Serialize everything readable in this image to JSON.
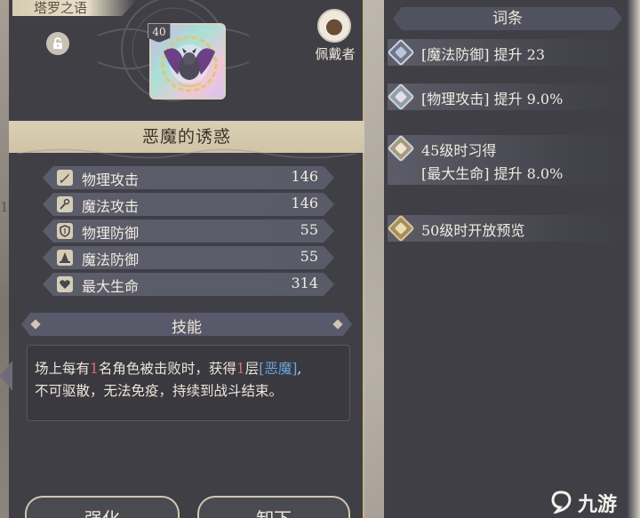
{
  "panel_title": "塔罗之语",
  "item": {
    "level": "40",
    "name": "恶魔的诱惑"
  },
  "wearer": {
    "label": "佩戴者"
  },
  "stats": [
    {
      "name": "物理攻击",
      "value": "146",
      "icon": "sword-icon"
    },
    {
      "name": "魔法攻击",
      "value": "146",
      "icon": "wand-icon"
    },
    {
      "name": "物理防御",
      "value": "55",
      "icon": "shield-icon"
    },
    {
      "name": "魔法防御",
      "value": "55",
      "icon": "wizard-hat-icon"
    },
    {
      "name": "最大生命",
      "value": "314",
      "icon": "heart-icon"
    }
  ],
  "skill": {
    "title": "技能",
    "desc_a": "场上每有",
    "desc_num1": "1",
    "desc_b": "名角色被击败时，获得",
    "desc_num2": "1",
    "desc_c": "层",
    "desc_tag": "[恶魔]",
    "desc_d": ",",
    "desc_line2": "不可驱散，无法免疫，持续到战斗结束。"
  },
  "buttons": {
    "enhance": "强化",
    "unequip": "卸下"
  },
  "entries": {
    "header": "词条",
    "items": [
      {
        "text": "[魔法防御] 提升 23",
        "gem": "blue-gem-icon"
      },
      {
        "text": "[物理攻击] 提升 9.0%",
        "gem": "teal-gem-icon"
      },
      {
        "line1": "45级时习得",
        "line2": "[最大生命] 提升 8.0%",
        "gem": "yellow-gem-icon"
      },
      {
        "text": "50级时开放预览",
        "gem": "gold-gem-icon"
      }
    ]
  },
  "watermark": "九游",
  "colors": {
    "panel_bg": "#3f3f45",
    "banner": "#d9cfb4",
    "highlight_number": "#e56b5a",
    "highlight_tag": "#6aa7e0"
  }
}
